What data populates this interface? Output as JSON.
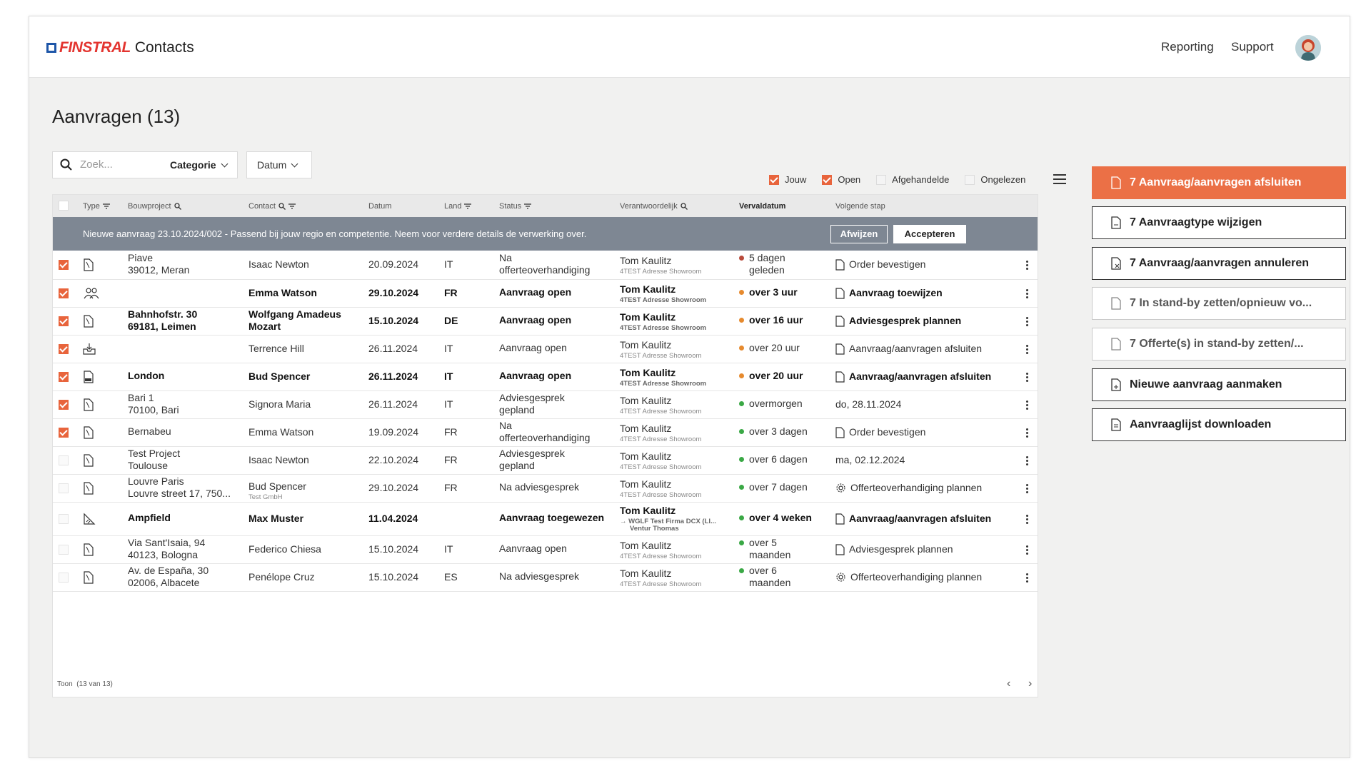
{
  "app": {
    "brand": "FINSTRAL",
    "product": "Contacts"
  },
  "nav": {
    "reporting": "Reporting",
    "support": "Support"
  },
  "page": {
    "title": "Aanvragen (13)"
  },
  "toolbar": {
    "search_placeholder": "Zoek...",
    "category_label": "Categorie",
    "date_label": "Datum"
  },
  "filters": {
    "jouw": "Jouw",
    "open": "Open",
    "afgehandelde": "Afgehandelde",
    "ongelezen": "Ongelezen"
  },
  "columns": {
    "type": "Type",
    "bouwproject": "Bouwproject",
    "contact": "Contact",
    "datum": "Datum",
    "land": "Land",
    "status": "Status",
    "verantwoordelijk": "Verantwoordelijk",
    "vervaldatum": "Vervaldatum",
    "volgende_stap": "Volgende stap"
  },
  "notice": {
    "text": "Nieuwe aanvraag 23.10.2024/002 - Passend bij jouw regio en competentie. Neem voor verdere details de verwerking over.",
    "reject": "Afwijzen",
    "accept": "Accepteren"
  },
  "rows": [
    {
      "project1": "Piave",
      "project2": "39012, Meran",
      "contact": "Isaac Newton",
      "contact_sub": "",
      "date": "20.09.2024",
      "country": "IT",
      "status1": "Na",
      "status2": "offerteoverhandiging",
      "resp": "Tom Kaulitz",
      "resp_sub": "4TEST Adresse Showroom",
      "due": "5 dagen",
      "due2": "geleden",
      "next": "Order bevestigen"
    },
    {
      "project1": "",
      "project2": "",
      "contact": "Emma Watson",
      "contact_sub": "",
      "date": "29.10.2024",
      "country": "FR",
      "status1": "Aanvraag open",
      "status2": "",
      "resp": "Tom Kaulitz",
      "resp_sub": "4TEST Adresse Showroom",
      "due": "over 3 uur",
      "due2": "",
      "next": "Aanvraag toewijzen"
    },
    {
      "project1": "Bahnhofstr. 30",
      "project2": "69181, Leimen",
      "contact": "Wolfgang Amadeus",
      "contact_sub": "Mozart",
      "date": "15.10.2024",
      "country": "DE",
      "status1": "Aanvraag open",
      "status2": "",
      "resp": "Tom Kaulitz",
      "resp_sub": "4TEST Adresse Showroom",
      "due": "over 16 uur",
      "due2": "",
      "next": "Adviesgesprek plannen"
    },
    {
      "project1": "",
      "project2": "",
      "contact": "Terrence Hill",
      "contact_sub": "",
      "date": "26.11.2024",
      "country": "IT",
      "status1": "Aanvraag open",
      "status2": "",
      "resp": "Tom Kaulitz",
      "resp_sub": "4TEST Adresse Showroom",
      "due": "over 20 uur",
      "due2": "",
      "next": "Aanvraag/aanvragen afsluiten"
    },
    {
      "project1": "London",
      "project2": "",
      "contact": "Bud Spencer",
      "contact_sub": "",
      "date": "26.11.2024",
      "country": "IT",
      "status1": "Aanvraag open",
      "status2": "",
      "resp": "Tom Kaulitz",
      "resp_sub": "4TEST Adresse Showroom",
      "due": "over 20 uur",
      "due2": "",
      "next": "Aanvraag/aanvragen afsluiten"
    },
    {
      "project1": "Bari 1",
      "project2": "70100, Bari",
      "contact": "Signora Maria",
      "contact_sub": "",
      "date": "26.11.2024",
      "country": "IT",
      "status1": "Adviesgesprek",
      "status2": "gepland",
      "resp": "Tom Kaulitz",
      "resp_sub": "4TEST Adresse Showroom",
      "due": "overmorgen",
      "due2": "",
      "next": "do, 28.11.2024"
    },
    {
      "project1": "Bernabeu",
      "project2": "",
      "contact": "Emma Watson",
      "contact_sub": "",
      "date": "19.09.2024",
      "country": "FR",
      "status1": "Na",
      "status2": "offerteoverhandiging",
      "resp": "Tom Kaulitz",
      "resp_sub": "4TEST Adresse Showroom",
      "due": "over 3 dagen",
      "due2": "",
      "next": "Order bevestigen"
    },
    {
      "project1": "Test Project",
      "project2": "Toulouse",
      "contact": "Isaac Newton",
      "contact_sub": "",
      "date": "22.10.2024",
      "country": "FR",
      "status1": "Adviesgesprek",
      "status2": "gepland",
      "resp": "Tom Kaulitz",
      "resp_sub": "4TEST Adresse Showroom",
      "due": "over 6 dagen",
      "due2": "",
      "next": "ma, 02.12.2024"
    },
    {
      "project1": "Louvre Paris",
      "project2": "Louvre street 17, 750...",
      "contact": "Bud Spencer",
      "contact_sub": "Test GmbH",
      "date": "29.10.2024",
      "country": "FR",
      "status1": "Na adviesgesprek",
      "status2": "",
      "resp": "Tom Kaulitz",
      "resp_sub": "4TEST Adresse Showroom",
      "due": "over 7 dagen",
      "due2": "",
      "next": "Offerteoverhandiging plannen"
    },
    {
      "project1": "Ampfield",
      "project2": "",
      "contact": "Max Muster",
      "contact_sub": "",
      "date": "11.04.2024",
      "country": "",
      "status1": "Aanvraag toegewezen",
      "status2": "",
      "resp": "Tom Kaulitz",
      "resp_sub": "→ WGLF Test Firma DCX (LI...",
      "resp_sub2": "Ventur Thomas",
      "due": "over 4 weken",
      "due2": "",
      "next": "Aanvraag/aanvragen afsluiten"
    },
    {
      "project1": "Via Sant'Isaia, 94",
      "project2": "40123, Bologna",
      "contact": "Federico Chiesa",
      "contact_sub": "",
      "date": "15.10.2024",
      "country": "IT",
      "status1": "Aanvraag open",
      "status2": "",
      "resp": "Tom Kaulitz",
      "resp_sub": "4TEST Adresse Showroom",
      "due": "over 5",
      "due2": "maanden",
      "next": "Adviesgesprek plannen"
    },
    {
      "project1": "Av. de España, 30",
      "project2": "02006, Albacete",
      "contact": "Penélope Cruz",
      "contact_sub": "",
      "date": "15.10.2024",
      "country": "ES",
      "status1": "Na adviesgesprek",
      "status2": "",
      "resp": "Tom Kaulitz",
      "resp_sub": "4TEST Adresse Showroom",
      "due": "over 6",
      "due2": "maanden",
      "next": "Offerteoverhandiging plannen"
    }
  ],
  "footer": {
    "show_label": "Toon",
    "count": "(13 van 13)"
  },
  "actions": [
    "7 Aanvraag/aanvragen afsluiten",
    "7 Aanvraagtype wijzigen",
    "7 Aanvraag/aanvragen annuleren",
    "7 In stand-by zetten/opnieuw vo...",
    "7 Offerte(s) in stand-by zetten/...",
    "Nieuwe aanvraag aanmaken",
    "Aanvraaglijst downloaden"
  ],
  "colors": {
    "accent": "#eb7046",
    "overdue": "#b94a3b",
    "soon": "#e68a2e",
    "ok": "#3aa845",
    "notice_bg": "#7e8793",
    "brand_red": "#e3342f",
    "brand_blue": "#1e56a8"
  }
}
